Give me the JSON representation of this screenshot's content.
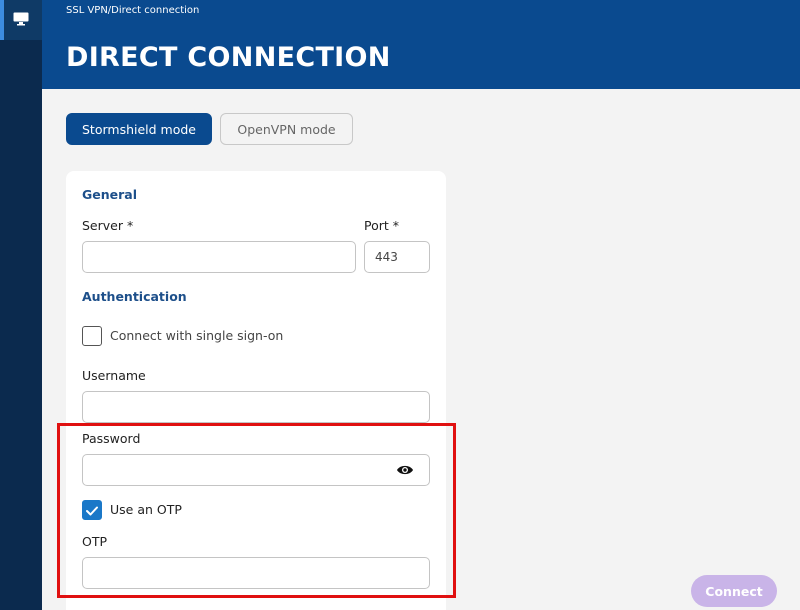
{
  "header": {
    "breadcrumb": "SSL VPN/Direct connection",
    "title": "DIRECT CONNECTION"
  },
  "sidebar": {
    "items": [
      {
        "icon": "monitor-icon",
        "active": true
      }
    ]
  },
  "modes": {
    "stormshield": "Stormshield mode",
    "openvpn": "OpenVPN mode",
    "selected": "stormshield"
  },
  "form": {
    "general_title": "General",
    "server_label": "Server  *",
    "server_value": "",
    "port_label": "Port  *",
    "port_value": "443",
    "auth_title": "Authentication",
    "sso_label": "Connect with single sign-on",
    "sso_checked": false,
    "username_label": "Username",
    "username_value": "",
    "password_label": "Password",
    "password_value": "",
    "otp_checkbox_label": "Use an OTP",
    "otp_checked": true,
    "otp_label": "OTP",
    "otp_value": ""
  },
  "actions": {
    "connect": "Connect"
  },
  "colors": {
    "header": "#0a4a8f",
    "sidebar": "#0b2a4e",
    "accent": "#1a78c8",
    "highlight": "#e01010",
    "connect_disabled": "#c9b4e8"
  }
}
